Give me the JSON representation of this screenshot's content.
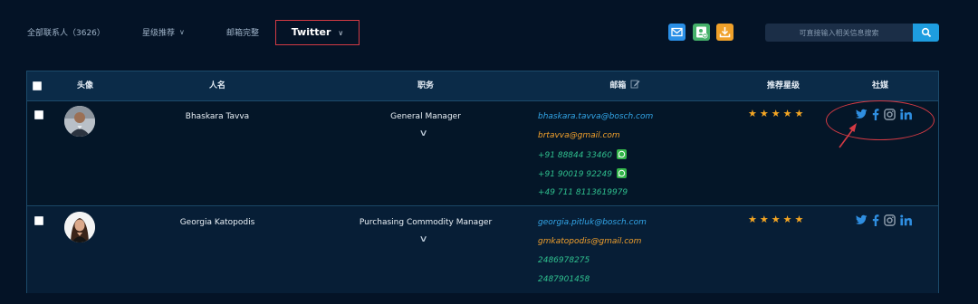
{
  "filters": {
    "all_contacts": "全部联系人（3626）",
    "star_recommend": "星级推荐",
    "email_complete": "邮箱完整",
    "active": "Twitter",
    "chevron": "﹀"
  },
  "toolbar": {
    "mail_icon": "mail-icon",
    "add_contact_icon": "add-contact-icon",
    "download_icon": "download-icon",
    "colors": {
      "mail": "#2a8fe6",
      "user": "#45b06a",
      "download": "#f0a12a"
    }
  },
  "search": {
    "placeholder": "可直接输入相关信息搜索",
    "button_color": "#1e9de0"
  },
  "table": {
    "headers": {
      "avatar": "头像",
      "name": "人名",
      "title": "职务",
      "email": "邮箱",
      "rating": "推荐星级",
      "social": "社媒"
    },
    "rows": [
      {
        "name": "Bhaskara Tavva",
        "title": "General Manager",
        "contacts": [
          {
            "text": "bhaskara.tavva@bosch.com",
            "kind": "work-email",
            "whatsapp": false
          },
          {
            "text": "brtavva@gmail.com",
            "kind": "personal-email",
            "whatsapp": false
          },
          {
            "text": "+91 88844 33460",
            "kind": "phone",
            "whatsapp": true
          },
          {
            "text": "+91 90019 92249",
            "kind": "phone",
            "whatsapp": true
          },
          {
            "text": "+49 711 8113619979",
            "kind": "phone",
            "whatsapp": false
          }
        ],
        "stars": "★★★★★",
        "rating": 5,
        "social": [
          "twitter",
          "facebook",
          "instagram",
          "linkedin"
        ]
      },
      {
        "name": "Georgia Katopodis",
        "title": "Purchasing Commodity Manager",
        "contacts": [
          {
            "text": "georgia.pitluk@bosch.com",
            "kind": "work-email",
            "whatsapp": false
          },
          {
            "text": "gmkatopodis@gmail.com",
            "kind": "personal-email",
            "whatsapp": false
          },
          {
            "text": "2486978275",
            "kind": "phone",
            "whatsapp": false
          },
          {
            "text": "2487901458",
            "kind": "phone",
            "whatsapp": false
          }
        ],
        "stars": "★★★★★",
        "rating": 5,
        "social": [
          "twitter",
          "facebook",
          "instagram",
          "linkedin"
        ]
      }
    ]
  },
  "colors": {
    "background": "#041326",
    "header_bg": "#0b2b48",
    "work_email": "#33a6e8",
    "personal_email": "#f3a12c",
    "phone": "#2fbf8e",
    "star": "#f5a623",
    "social": "#2f8ee0",
    "annotation": "#d43a44"
  }
}
